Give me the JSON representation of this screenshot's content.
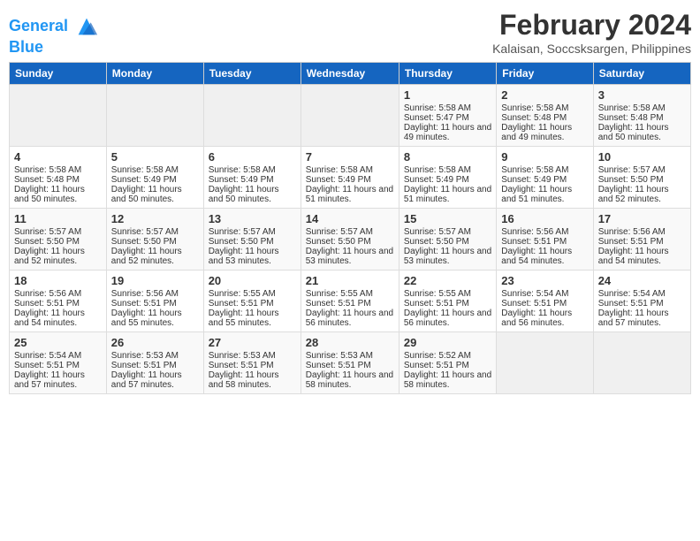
{
  "logo": {
    "line1": "General",
    "line2": "Blue"
  },
  "title": "February 2024",
  "subtitle": "Kalaisan, Soccsksargen, Philippines",
  "days": [
    "Sunday",
    "Monday",
    "Tuesday",
    "Wednesday",
    "Thursday",
    "Friday",
    "Saturday"
  ],
  "weeks": [
    [
      {
        "day": "",
        "empty": true
      },
      {
        "day": "",
        "empty": true
      },
      {
        "day": "",
        "empty": true
      },
      {
        "day": "",
        "empty": true
      },
      {
        "day": "1",
        "sunrise": "5:58 AM",
        "sunset": "5:47 PM",
        "daylight": "11 hours and 49 minutes."
      },
      {
        "day": "2",
        "sunrise": "5:58 AM",
        "sunset": "5:48 PM",
        "daylight": "11 hours and 49 minutes."
      },
      {
        "day": "3",
        "sunrise": "5:58 AM",
        "sunset": "5:48 PM",
        "daylight": "11 hours and 50 minutes."
      }
    ],
    [
      {
        "day": "4",
        "sunrise": "5:58 AM",
        "sunset": "5:48 PM",
        "daylight": "11 hours and 50 minutes."
      },
      {
        "day": "5",
        "sunrise": "5:58 AM",
        "sunset": "5:49 PM",
        "daylight": "11 hours and 50 minutes."
      },
      {
        "day": "6",
        "sunrise": "5:58 AM",
        "sunset": "5:49 PM",
        "daylight": "11 hours and 50 minutes."
      },
      {
        "day": "7",
        "sunrise": "5:58 AM",
        "sunset": "5:49 PM",
        "daylight": "11 hours and 51 minutes."
      },
      {
        "day": "8",
        "sunrise": "5:58 AM",
        "sunset": "5:49 PM",
        "daylight": "11 hours and 51 minutes."
      },
      {
        "day": "9",
        "sunrise": "5:58 AM",
        "sunset": "5:49 PM",
        "daylight": "11 hours and 51 minutes."
      },
      {
        "day": "10",
        "sunrise": "5:57 AM",
        "sunset": "5:50 PM",
        "daylight": "11 hours and 52 minutes."
      }
    ],
    [
      {
        "day": "11",
        "sunrise": "5:57 AM",
        "sunset": "5:50 PM",
        "daylight": "11 hours and 52 minutes."
      },
      {
        "day": "12",
        "sunrise": "5:57 AM",
        "sunset": "5:50 PM",
        "daylight": "11 hours and 52 minutes."
      },
      {
        "day": "13",
        "sunrise": "5:57 AM",
        "sunset": "5:50 PM",
        "daylight": "11 hours and 53 minutes."
      },
      {
        "day": "14",
        "sunrise": "5:57 AM",
        "sunset": "5:50 PM",
        "daylight": "11 hours and 53 minutes."
      },
      {
        "day": "15",
        "sunrise": "5:57 AM",
        "sunset": "5:50 PM",
        "daylight": "11 hours and 53 minutes."
      },
      {
        "day": "16",
        "sunrise": "5:56 AM",
        "sunset": "5:51 PM",
        "daylight": "11 hours and 54 minutes."
      },
      {
        "day": "17",
        "sunrise": "5:56 AM",
        "sunset": "5:51 PM",
        "daylight": "11 hours and 54 minutes."
      }
    ],
    [
      {
        "day": "18",
        "sunrise": "5:56 AM",
        "sunset": "5:51 PM",
        "daylight": "11 hours and 54 minutes."
      },
      {
        "day": "19",
        "sunrise": "5:56 AM",
        "sunset": "5:51 PM",
        "daylight": "11 hours and 55 minutes."
      },
      {
        "day": "20",
        "sunrise": "5:55 AM",
        "sunset": "5:51 PM",
        "daylight": "11 hours and 55 minutes."
      },
      {
        "day": "21",
        "sunrise": "5:55 AM",
        "sunset": "5:51 PM",
        "daylight": "11 hours and 56 minutes."
      },
      {
        "day": "22",
        "sunrise": "5:55 AM",
        "sunset": "5:51 PM",
        "daylight": "11 hours and 56 minutes."
      },
      {
        "day": "23",
        "sunrise": "5:54 AM",
        "sunset": "5:51 PM",
        "daylight": "11 hours and 56 minutes."
      },
      {
        "day": "24",
        "sunrise": "5:54 AM",
        "sunset": "5:51 PM",
        "daylight": "11 hours and 57 minutes."
      }
    ],
    [
      {
        "day": "25",
        "sunrise": "5:54 AM",
        "sunset": "5:51 PM",
        "daylight": "11 hours and 57 minutes."
      },
      {
        "day": "26",
        "sunrise": "5:53 AM",
        "sunset": "5:51 PM",
        "daylight": "11 hours and 57 minutes."
      },
      {
        "day": "27",
        "sunrise": "5:53 AM",
        "sunset": "5:51 PM",
        "daylight": "11 hours and 58 minutes."
      },
      {
        "day": "28",
        "sunrise": "5:53 AM",
        "sunset": "5:51 PM",
        "daylight": "11 hours and 58 minutes."
      },
      {
        "day": "29",
        "sunrise": "5:52 AM",
        "sunset": "5:51 PM",
        "daylight": "11 hours and 58 minutes."
      },
      {
        "day": "",
        "empty": true
      },
      {
        "day": "",
        "empty": true
      }
    ]
  ]
}
